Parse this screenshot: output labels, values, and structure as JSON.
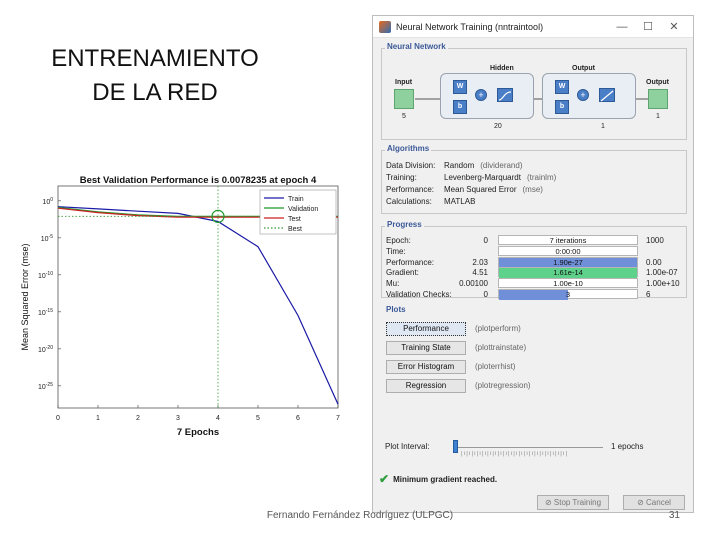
{
  "slide": {
    "title_line1": "ENTRENAMIENTO",
    "title_line2": "DE LA RED",
    "footer": "Fernando Fernández Rodríguez (ULPGC)",
    "page_number": "31"
  },
  "chart_data": {
    "type": "line",
    "title": "Best Validation Performance is 0.0078235 at epoch 4",
    "xlabel": "7 Epochs",
    "ylabel": "Mean Squared Error  (mse)",
    "xlim": [
      0,
      7
    ],
    "x_ticks": [
      "0",
      "1",
      "2",
      "3",
      "4",
      "5",
      "6",
      "7"
    ],
    "y_ticks_exponent": [
      "0",
      "-5",
      "-10",
      "-15",
      "-20",
      "-25"
    ],
    "y_tick_base": "10",
    "ylim_log10": [
      -28,
      2
    ],
    "yscale": "log",
    "legend_position": "top-right",
    "series": [
      {
        "name": "Train",
        "color": "#1a1aa6",
        "x": [
          0,
          1,
          2,
          3,
          4,
          5,
          6,
          7
        ],
        "log10_y": [
          -0.8,
          -1.1,
          -1.4,
          -1.7,
          -2.8,
          -6.2,
          -15.5,
          -27.5
        ]
      },
      {
        "name": "Validation",
        "color": "#1f9a2f",
        "x": [
          0,
          1,
          2,
          3,
          4,
          5,
          6,
          7
        ],
        "log10_y": [
          -0.9,
          -1.5,
          -1.9,
          -2.1,
          -2.1,
          -2.1,
          -2.1,
          -2.1
        ]
      },
      {
        "name": "Test",
        "color": "#cc2222",
        "x": [
          0,
          1,
          2,
          3,
          4,
          5,
          6,
          7
        ],
        "log10_y": [
          -1.0,
          -1.6,
          -2.0,
          -2.2,
          -2.2,
          -2.2,
          -2.2,
          -2.2
        ]
      },
      {
        "name": "Best",
        "color": "#339933",
        "style": "dotted",
        "x": [
          0,
          7
        ],
        "log10_y": [
          -2.1,
          -2.1
        ]
      }
    ],
    "best_epoch": 4
  },
  "window": {
    "title": "Neural Network Training (nntraintool)",
    "minimize": "—",
    "maximize": "☐",
    "close": "✕"
  },
  "network": {
    "panel_title": "Neural Network",
    "hidden_label": "Hidden",
    "output_label": "Output",
    "input_label": "Input",
    "output_node_label": "Output",
    "input_size": "5",
    "hidden_size": "20",
    "output_size": "1",
    "final_size": "1",
    "w_label": "W",
    "b_label": "b",
    "plus": "+"
  },
  "algorithms": {
    "panel_title": "Algorithms",
    "rows": [
      {
        "key": "Data Division:",
        "value": "Random",
        "fn": "(dividerand)"
      },
      {
        "key": "Training:",
        "value": "Levenberg-Marquardt",
        "fn": "(trainlm)"
      },
      {
        "key": "Performance:",
        "value": "Mean Squared Error",
        "fn": "(mse)"
      },
      {
        "key": "Calculations:",
        "value": "MATLAB",
        "fn": ""
      }
    ]
  },
  "progress": {
    "panel_title": "Progress",
    "rows": [
      {
        "key": "Epoch:",
        "start": "0",
        "bar_text": "7 iterations",
        "fill": 0.0,
        "fill_color": "#ffffff",
        "end": "1000"
      },
      {
        "key": "Time:",
        "start": "",
        "bar_text": "0:00:00",
        "fill": 0.0,
        "fill_color": "#ffffff",
        "end": ""
      },
      {
        "key": "Performance:",
        "start": "2.03",
        "bar_text": "1.90e-27",
        "fill": 1.0,
        "fill_color": "#6f8fd8",
        "end": "0.00"
      },
      {
        "key": "Gradient:",
        "start": "4.51",
        "bar_text": "1.61e-14",
        "fill": 1.0,
        "fill_color": "#5ed18a",
        "end": "1.00e-07"
      },
      {
        "key": "Mu:",
        "start": "0.00100",
        "bar_text": "1.00e-10",
        "fill": 0.0,
        "fill_color": "#ffffff",
        "end": "1.00e+10"
      },
      {
        "key": "Validation Checks:",
        "start": "0",
        "bar_text": "3",
        "fill": 0.5,
        "fill_color": "#6f8fd8",
        "end": "6"
      }
    ]
  },
  "plots": {
    "panel_title": "Plots",
    "buttons": [
      {
        "label": "Performance",
        "fn": "(plotperform)"
      },
      {
        "label": "Training State",
        "fn": "(plottrainstate)"
      },
      {
        "label": "Error Histogram",
        "fn": "(ploterrhist)"
      },
      {
        "label": "Regression",
        "fn": "(plotregression)"
      }
    ],
    "interval_label": "Plot Interval:",
    "interval_value": "1 epochs",
    "interval_ticks": "|ı|ı|ı|ı|ı|ı|ı|ı|ı|ı|ı|ı|ı|ı|ı|ı|ı|ı|ı|ı|"
  },
  "status": {
    "message": "Minimum gradient reached.",
    "check_icon": "✔"
  },
  "buttons": {
    "stop_training": "Stop Training",
    "cancel": "Cancel"
  }
}
